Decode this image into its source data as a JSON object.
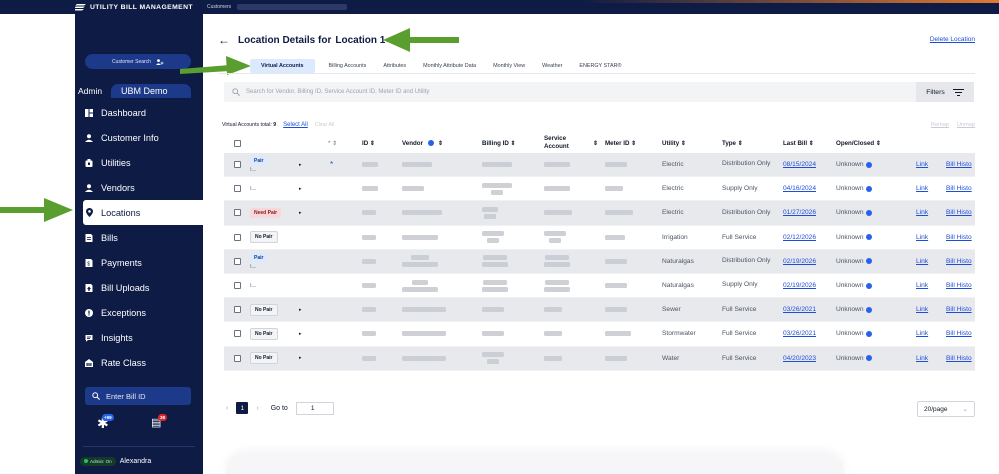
{
  "app": {
    "brand": "UTILITY BILL MANAGEMENT",
    "breadcrumb": "Customers"
  },
  "sidebar": {
    "customer_search": "Customer Search",
    "admin_label": "Admin",
    "org_name": "UBM Demo",
    "items": [
      {
        "label": "Dashboard",
        "icon": "dashboard-icon"
      },
      {
        "label": "Customer Info",
        "icon": "person-icon"
      },
      {
        "label": "Utilities",
        "icon": "utility-icon"
      },
      {
        "label": "Vendors",
        "icon": "person-icon"
      },
      {
        "label": "Locations",
        "icon": "location-pin-icon",
        "active": true
      },
      {
        "label": "Bills",
        "icon": "bill-icon"
      },
      {
        "label": "Payments",
        "icon": "payment-icon"
      },
      {
        "label": "Bill Uploads",
        "icon": "upload-icon"
      },
      {
        "label": "Exceptions",
        "icon": "exclamation-icon"
      },
      {
        "label": "Insights",
        "icon": "insights-icon"
      },
      {
        "label": "Rate Class",
        "icon": "rate-class-icon"
      }
    ],
    "bill_search": "Enter Bill ID",
    "badge_1": "+99",
    "badge_2": "38",
    "admin_on": "Admin: On",
    "user_name": "Alexandra"
  },
  "main": {
    "title_prefix": "Location Details for",
    "title_location": "Location 1",
    "delete_link": "Delete Location",
    "tabs": [
      "Virtual Accounts",
      "Billing Accounts",
      "Attributes",
      "Monthly Attribute Data",
      "Monthly View",
      "Weather",
      "ENERGY STAR®"
    ],
    "search_placeholder": "Search for Vendor, Billing ID, Service Account ID, Meter ID and Utility",
    "filters_label": "Filters",
    "accounts_total_label": "Virtual Accounts total:",
    "accounts_total": "9",
    "select_all": "Select All",
    "clear_all": "Clear All",
    "remap": "Remap",
    "unmap": "Unmap"
  },
  "table": {
    "headers": {
      "id": "ID ⇕",
      "vendor": "Vendor",
      "vendor_sort": "⇕",
      "billing_id": "Billing ID ⇕",
      "service_account": "Service Account",
      "service_sort": "⇕",
      "meter_id": "Meter ID ⇕",
      "utility": "Utility ⇕",
      "type": "Type ⇕",
      "last_bill": "Last Bill ⇕",
      "open_closed": "Open/Closed ⇕",
      "star_sort": "* ⇕"
    },
    "rows": [
      {
        "pair": "Pair",
        "utility": "Electric",
        "type": "Distribution Only",
        "last_bill": "08/15/2024",
        "status": "Unknown",
        "link": "Link",
        "history": "Bill Histo",
        "star": "*"
      },
      {
        "pair": "",
        "utility": "Electric",
        "type": "Supply Only",
        "last_bill": "04/16/2024",
        "status": "Unknown",
        "link": "Link",
        "history": "Bill Histo"
      },
      {
        "pair": "Need Pair",
        "utility": "Electric",
        "type": "Distribution Only",
        "last_bill": "01/27/2026",
        "status": "Unknown",
        "link": "Link",
        "history": "Bill Histo"
      },
      {
        "pair": "No Pair",
        "utility": "Irrigation",
        "type": "Full Service",
        "last_bill": "02/12/2026",
        "status": "Unknown",
        "link": "Link",
        "history": "Bill Histo"
      },
      {
        "pair": "Pair",
        "utility": "Naturalgas",
        "type": "Distribution Only",
        "last_bill": "02/19/2026",
        "status": "Unknown",
        "link": "Link",
        "history": "Bill Histo"
      },
      {
        "pair": "",
        "utility": "Naturalgas",
        "type": "Supply Only",
        "last_bill": "02/19/2026",
        "status": "Unknown",
        "link": "Link",
        "history": "Bill Histo"
      },
      {
        "pair": "No Pair",
        "utility": "Sewer",
        "type": "Full Service",
        "last_bill": "03/26/2021",
        "status": "Unknown",
        "link": "Link",
        "history": "Bill Histo"
      },
      {
        "pair": "No Pair",
        "utility": "Stormwater",
        "type": "Full Service",
        "last_bill": "03/26/2021",
        "status": "Unknown",
        "link": "Link",
        "history": "Bill Histo"
      },
      {
        "pair": "No Pair",
        "utility": "Water",
        "type": "Full Service",
        "last_bill": "04/20/2023",
        "status": "Unknown",
        "link": "Link",
        "history": "Bill Histo"
      }
    ]
  },
  "pager": {
    "current": "1",
    "goto_label": "Go to",
    "goto_value": "1",
    "per_page": "20/page"
  },
  "colors": {
    "sidebar_bg": "#0d1b45",
    "accent_blue": "#1d4ed8",
    "arrow_green": "#5a9e2f"
  }
}
